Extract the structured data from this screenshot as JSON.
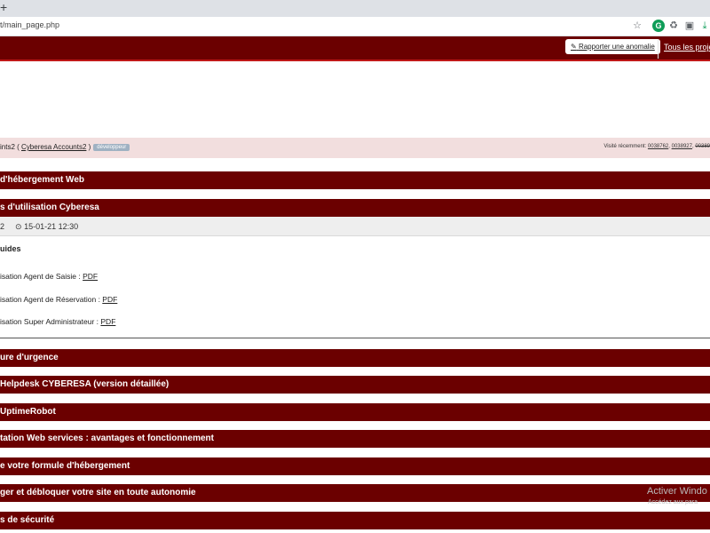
{
  "browser": {
    "new_tab_glyph": "+",
    "url": "t/main_page.php",
    "toolbar_icons": [
      "star-icon",
      "grammarly-icon",
      "recycle-icon",
      "extension-icon",
      "download-icon"
    ]
  },
  "header": {
    "report_label": "Rapporter une anomalie",
    "all_projects_label": "Tous les proje",
    "background_color": "#6b0000"
  },
  "breadcrumb": {
    "prefix": "ints2 ( ",
    "link": "Cyberesa Accounts2",
    "suffix": " )",
    "role_badge": "développeur",
    "recent_label": "Visité récemment: ",
    "recent_items": [
      "0038762",
      "0038927",
      "00389"
    ]
  },
  "sections": [
    {
      "title": "d'hébergement Web"
    },
    {
      "title": "s d'utilisation Cyberesa"
    },
    {
      "title": "ure d'urgence"
    },
    {
      "title": "Helpdesk CYBERESA (version détaillée)"
    },
    {
      "title": "UptimeRobot"
    },
    {
      "title": "tation Web services : avantages et fonctionnement"
    },
    {
      "title": "e votre formule d'hébergement"
    },
    {
      "title": "ger et débloquer votre site en toute autonomie"
    },
    {
      "title": "s de sécurité"
    }
  ],
  "open_section": {
    "meta_id": "2",
    "meta_datetime": "15-01-21 12:30",
    "heading": "uides",
    "guides": [
      {
        "label": "isation Agent de Saisie : ",
        "link": "PDF"
      },
      {
        "label": "isation Agent de Réservation : ",
        "link": "PDF"
      },
      {
        "label": "isation Super Administrateur : ",
        "link": "PDF"
      }
    ]
  },
  "watermark": {
    "line1": "Activer Windo",
    "line2": "Accédez aux para"
  }
}
